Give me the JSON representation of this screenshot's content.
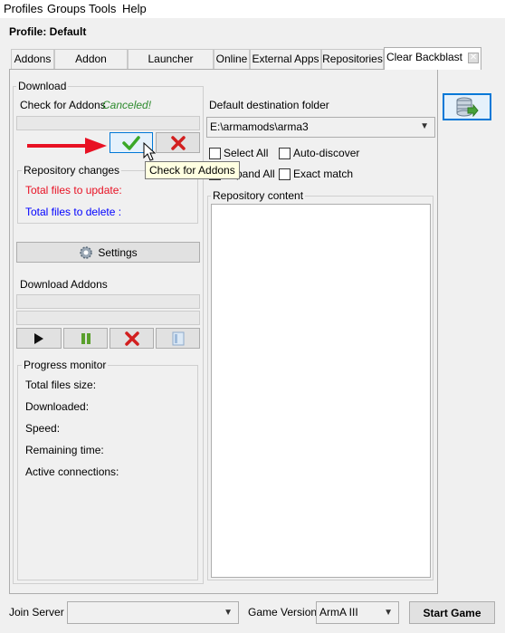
{
  "menu": {
    "items": [
      "Profiles",
      "Groups",
      "Tools",
      "Help"
    ]
  },
  "profile": {
    "label": "Profile: Default"
  },
  "tabs": [
    {
      "label": "Addons"
    },
    {
      "label": "Addon Options"
    },
    {
      "label": "Launcher Options"
    },
    {
      "label": "Online"
    },
    {
      "label": "External Apps"
    },
    {
      "label": "Repositories"
    },
    {
      "label": "Clear Backblast"
    }
  ],
  "download": {
    "group_title": "Download",
    "check_label": "Check for Addons",
    "check_status": "Canceled!",
    "tooltip": "Check for Addons",
    "repo_changes": {
      "title": "Repository changes",
      "update_label": "Total files to update:",
      "delete_label": "Total files to delete :"
    },
    "settings_label": "Settings",
    "download_addons_label": "Download Addons",
    "progress": {
      "title": "Progress monitor",
      "size": "Total files size:",
      "downloaded": "Downloaded:",
      "speed": "Speed:",
      "remaining": "Remaining time:",
      "connections": "Active connections:"
    }
  },
  "destination": {
    "label": "Default destination folder",
    "value": "E:\\armamods\\arma3",
    "select_all": "Select All",
    "auto_discover": "Auto-discover",
    "expand_all": "Expand All",
    "exact_match": "Exact match",
    "content_title": "Repository content"
  },
  "bottom": {
    "join_server_label": "Join Server",
    "join_server_value": "",
    "game_version_label": "Game Version",
    "game_version_value": "ArmA III",
    "start_label": "Start Game"
  },
  "colors": {
    "update_text": "#e81123",
    "delete_text": "#0000ff",
    "status_text": "#2e8b2e",
    "arrow": "#e81123"
  }
}
